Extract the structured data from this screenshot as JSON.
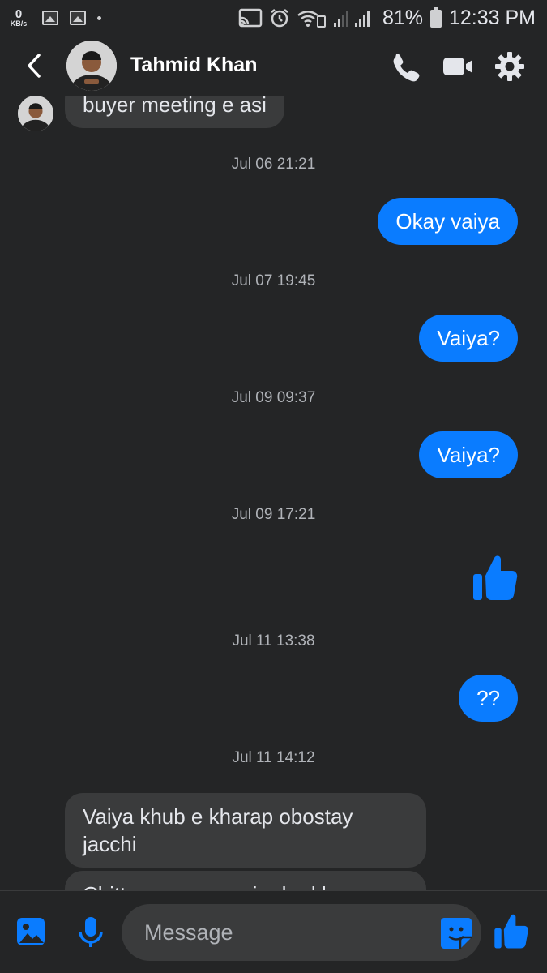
{
  "status_bar": {
    "net_speed_value": "0",
    "net_speed_unit": "KB/s",
    "battery": "81%",
    "time": "12:33 PM"
  },
  "header": {
    "contact_name": "Tahmid Khan",
    "icons": [
      "back-arrow-icon",
      "phone-icon",
      "video-camera-icon",
      "gear-icon"
    ]
  },
  "messages": {
    "incoming_partial": "buyer meeting e asi",
    "ts1": "Jul 06 21:21",
    "out1": "Okay vaiya",
    "ts2": "Jul 07 19:45",
    "out2": "Vaiya?",
    "ts3": "Jul 09 09:37",
    "out3": "Vaiya?",
    "ts4": "Jul 09 17:21",
    "out4_icon": "thumbs-up-icon",
    "ts5": "Jul 11 13:38",
    "out5": "??",
    "ts6": "Jul 11 14:12",
    "in2": "Vaiya khub e kharap obostay jacchi",
    "in3_partial": "Chittagong e cousin der kharap"
  },
  "composer": {
    "placeholder": "Message",
    "icons": [
      "image-icon",
      "microphone-icon",
      "sticker-icon",
      "thumbs-up-icon"
    ]
  },
  "colors": {
    "background": "#242526",
    "accent": "#0a7cff",
    "incoming_bubble": "#3a3b3c"
  }
}
